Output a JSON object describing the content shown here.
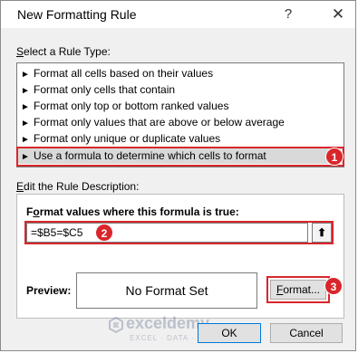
{
  "dialog": {
    "title": "New Formatting Rule",
    "help_glyph": "?",
    "close_glyph": "✕"
  },
  "rule_type": {
    "label_prefix": "",
    "label_access": "S",
    "label_rest": "elect a Rule Type:",
    "items": [
      {
        "arrow": "►",
        "label": "Format all cells based on their values"
      },
      {
        "arrow": "►",
        "label": "Format only cells that contain"
      },
      {
        "arrow": "►",
        "label": "Format only top or bottom ranked values"
      },
      {
        "arrow": "►",
        "label": "Format only values that are above or below average"
      },
      {
        "arrow": "►",
        "label": "Format only unique or duplicate values"
      },
      {
        "arrow": "►",
        "label": "Use a formula to determine which cells to format"
      }
    ],
    "selected_index": 5
  },
  "description": {
    "label_access": "E",
    "label_rest": "dit the Rule Description:",
    "formula_label_access": "o",
    "formula_label_pre": "F",
    "formula_label_rest": "rmat values where this formula is true:",
    "formula_value": "=$B5=$C5",
    "collapse_icon": "⬆",
    "preview_label": "Preview:",
    "preview_text": "No Format Set",
    "format_button_pre": "",
    "format_button_access": "F",
    "format_button_rest": "ormat..."
  },
  "buttons": {
    "ok": "OK",
    "cancel": "Cancel"
  },
  "annotations": {
    "step1": "1",
    "step2": "2",
    "step3": "3",
    "color": "#d9262b"
  },
  "watermark": {
    "name": "exceldemy",
    "tagline": "EXCEL · DATA · BI"
  }
}
